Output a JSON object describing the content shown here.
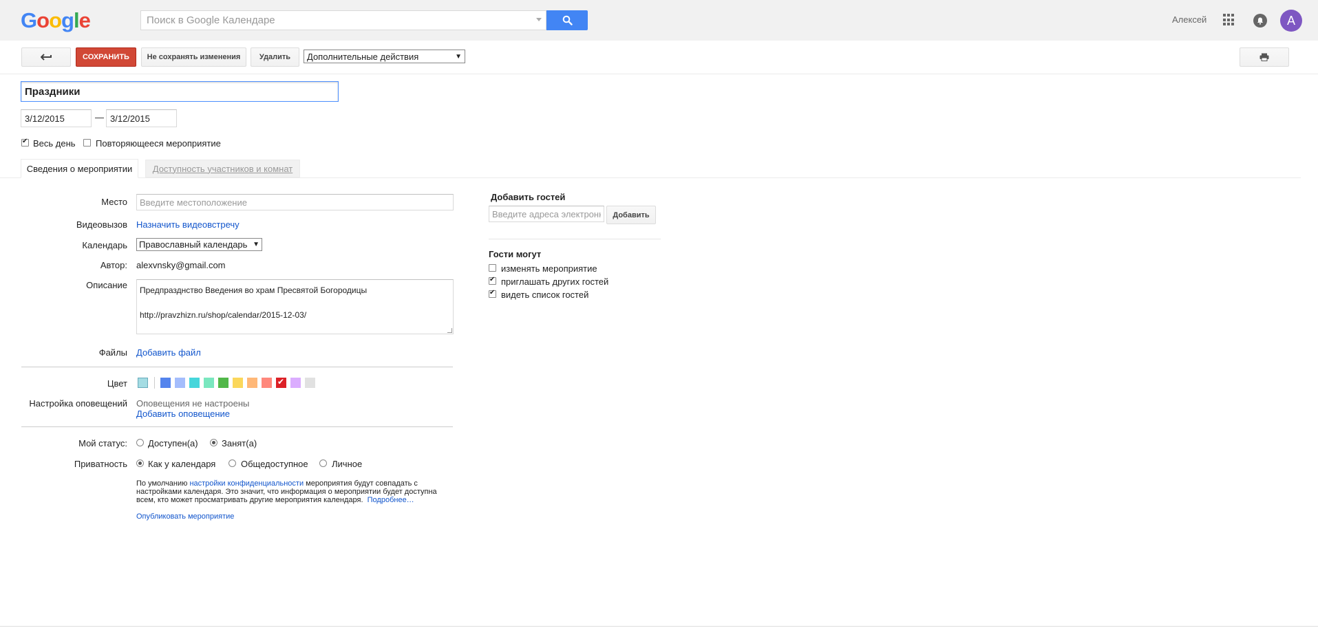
{
  "header": {
    "logo_letters": [
      {
        "ch": "G",
        "color": "#4285f4"
      },
      {
        "ch": "o",
        "color": "#ea4335"
      },
      {
        "ch": "o",
        "color": "#fbbc05"
      },
      {
        "ch": "g",
        "color": "#4285f4"
      },
      {
        "ch": "l",
        "color": "#34a853"
      },
      {
        "ch": "e",
        "color": "#ea4335"
      }
    ],
    "search_placeholder": "Поиск в Google Календаре",
    "user_name": "Алексей",
    "avatar_letter": "A"
  },
  "toolbar": {
    "back_icon": "back-arrow-icon",
    "save_label": "СОХРАНИТЬ",
    "discard_label": "Не сохранять изменения",
    "delete_label": "Удалить",
    "more_actions_value": "Дополнительные действия",
    "print_icon": "print-icon"
  },
  "event": {
    "title": "Праздники",
    "start_date": "3/12/2015",
    "date_separator": "—",
    "end_date": "3/12/2015",
    "all_day_label": "Весь день",
    "all_day_checked": true,
    "repeat_label": "Повторяющееся мероприятие",
    "repeat_checked": false
  },
  "tabs": {
    "details": "Сведения о мероприятии",
    "availability": "Доступность участников и комнат"
  },
  "details": {
    "location_label": "Место",
    "location_placeholder": "Введите местоположение",
    "video_label": "Видеовызов",
    "video_link": "Назначить видеовстречу",
    "calendar_label": "Календарь",
    "calendar_value": "Православный календарь",
    "author_label": "Автор:",
    "author_value": "alexvnsky@gmail.com",
    "description_label": "Описание",
    "description_line1": "Предпразднство Введения во храм Пресвятой Богородицы",
    "description_line2": "http://pravzhizn.ru/shop/calendar/2015-12-03/",
    "files_label": "Файлы",
    "files_link": "Добавить файл",
    "color_label": "Цвет",
    "notifications_label": "Настройка оповещений",
    "notifications_status": "Оповещения не настроены",
    "notifications_link": "Добавить оповещение",
    "status_label": "Мой статус:",
    "status_free": "Доступен(а)",
    "status_busy": "Занят(а)",
    "status_selected": "busy",
    "privacy_label": "Приватность",
    "privacy_default": "Как у календаря",
    "privacy_public": "Общедоступное",
    "privacy_private": "Личное",
    "privacy_selected": "default",
    "privacy_note_1": "По умолчанию ",
    "privacy_note_link": "настройки конфиденциальности",
    "privacy_note_2": " мероприятия будут совпадать с",
    "privacy_note_line2": "настройками календаря. Это значит, что информация о мероприятии будет доступна",
    "privacy_note_line3": "всем, кто может просматривать другие мероприятия календаря.",
    "privacy_more_link": "Подробнее…",
    "publish_link": "Опубликовать мероприятие"
  },
  "colors": {
    "default_swatch": "#a4dce3",
    "swatches": [
      "#5484ed",
      "#a4bdfc",
      "#46d6db",
      "#7ae7bf",
      "#51b749",
      "#fbd75b",
      "#ffb878",
      "#ff887c",
      "#dc2127",
      "#dbadff",
      "#e1e1e1"
    ],
    "selected_index": 8
  },
  "guests": {
    "title": "Добавить гостей",
    "input_placeholder": "Введите адреса электронной почты",
    "add_button": "Добавить",
    "can_title": "Гости могут",
    "perm_modify": "изменять мероприятие",
    "perm_modify_checked": false,
    "perm_invite": "приглашать других гостей",
    "perm_invite_checked": true,
    "perm_see": "видеть список гостей",
    "perm_see_checked": true
  }
}
